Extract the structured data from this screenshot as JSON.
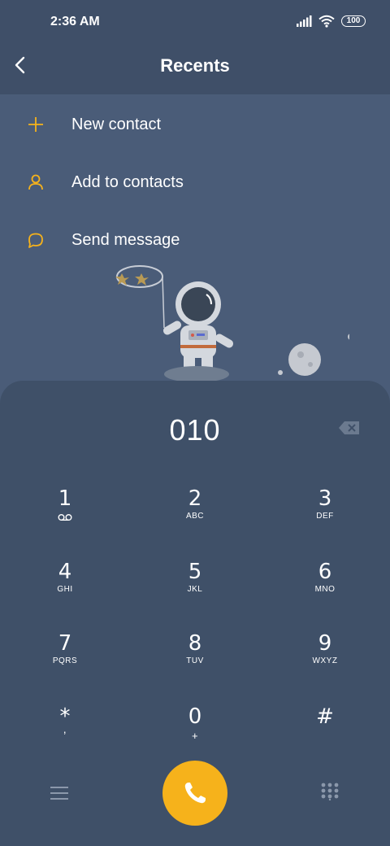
{
  "status_bar": {
    "time": "2:36 AM",
    "battery": "100"
  },
  "header": {
    "title": "Recents"
  },
  "actions": [
    {
      "label": "New contact",
      "icon": "plus-icon"
    },
    {
      "label": "Add to contacts",
      "icon": "person-icon"
    },
    {
      "label": "Send message",
      "icon": "message-icon"
    }
  ],
  "dialer": {
    "number": "010",
    "keys": [
      {
        "digit": "1",
        "letters": ""
      },
      {
        "digit": "2",
        "letters": "ABC"
      },
      {
        "digit": "3",
        "letters": "DEF"
      },
      {
        "digit": "4",
        "letters": "GHI"
      },
      {
        "digit": "5",
        "letters": "JKL"
      },
      {
        "digit": "6",
        "letters": "MNO"
      },
      {
        "digit": "7",
        "letters": "PQRS"
      },
      {
        "digit": "8",
        "letters": "TUV"
      },
      {
        "digit": "9",
        "letters": "WXYZ"
      },
      {
        "digit": "*",
        "letters": ","
      },
      {
        "digit": "0",
        "letters": "+"
      },
      {
        "digit": "#",
        "letters": ""
      }
    ]
  },
  "colors": {
    "accent": "#f6b21b",
    "background": "#4a5c78",
    "panel": "#3f5068"
  }
}
